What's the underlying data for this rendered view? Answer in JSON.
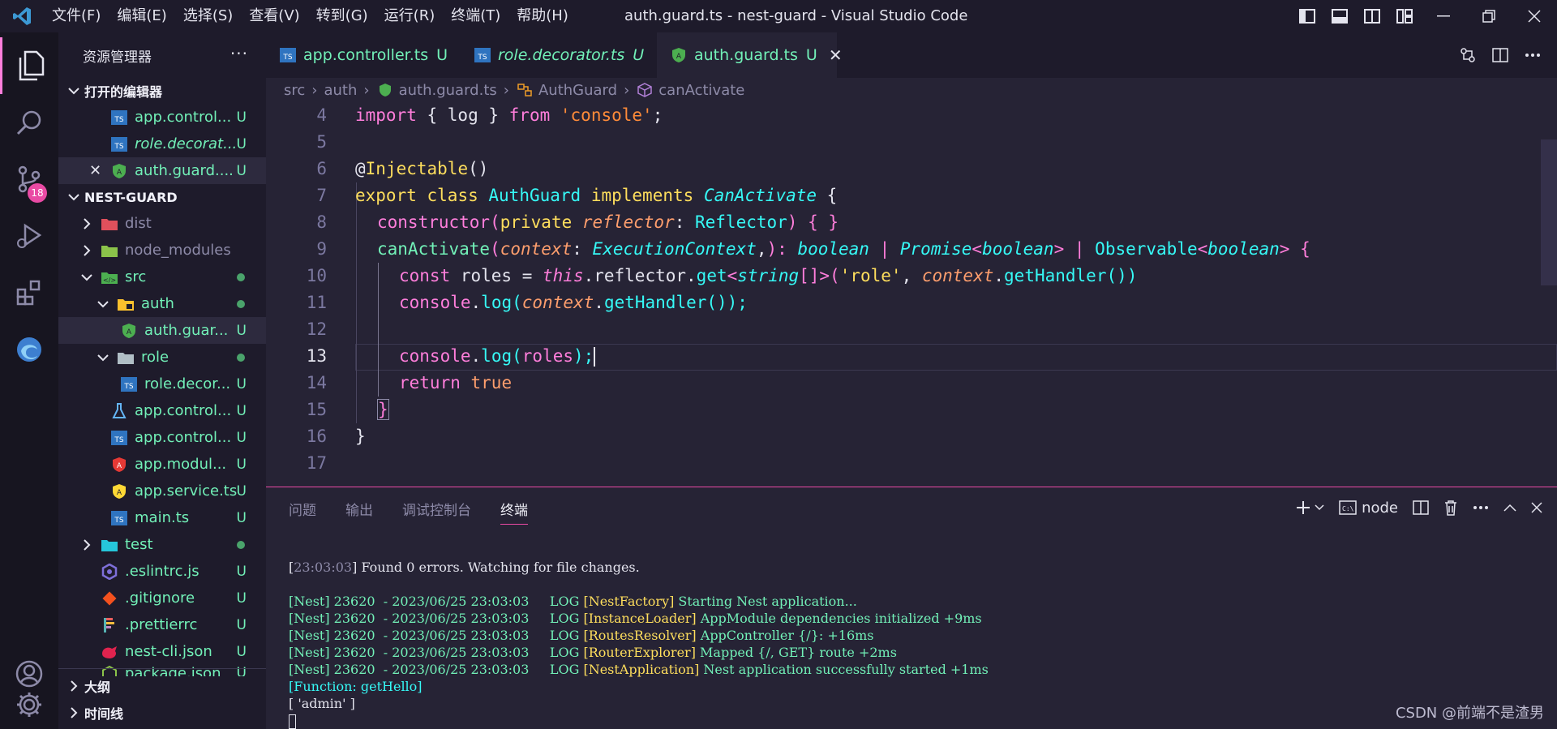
{
  "window": {
    "title": "auth.guard.ts - nest-guard - Visual Studio Code",
    "menu": [
      "文件(F)",
      "编辑(E)",
      "选择(S)",
      "查看(V)",
      "转到(G)",
      "运行(R)",
      "终端(T)",
      "帮助(H)"
    ]
  },
  "activity": {
    "scm_badge": "18"
  },
  "sidebar": {
    "title": "资源管理器",
    "dots": "···",
    "open_editors_title": "打开的编辑器",
    "open_editors": [
      {
        "name": "app.control...",
        "status": "U"
      },
      {
        "name": "role.decorat...",
        "status": "U"
      },
      {
        "name": "auth.guard....",
        "status": "U"
      }
    ],
    "project_title": "NEST-GUARD",
    "tree": [
      {
        "name": "dist"
      },
      {
        "name": "node_modules"
      },
      {
        "name": "src"
      },
      {
        "name": "auth"
      },
      {
        "name": "auth.guar...",
        "status": "U"
      },
      {
        "name": "role"
      },
      {
        "name": "role.decor...",
        "status": "U"
      },
      {
        "name": "app.control...",
        "status": "U"
      },
      {
        "name": "app.control...",
        "status": "U"
      },
      {
        "name": "app.modul...",
        "status": "U"
      },
      {
        "name": "app.service.ts",
        "status": "U"
      },
      {
        "name": "main.ts",
        "status": "U"
      },
      {
        "name": "test"
      },
      {
        "name": ".eslintrc.js",
        "status": "U"
      },
      {
        "name": ".gitignore",
        "status": "U"
      },
      {
        "name": ".prettierrc",
        "status": "U"
      },
      {
        "name": "nest-cli.json",
        "status": "U"
      },
      {
        "name": "package.json",
        "status": "U"
      }
    ],
    "outline_title": "大纲",
    "timeline_title": "时间线"
  },
  "tabs": [
    {
      "label": "app.controller.ts",
      "status": "U"
    },
    {
      "label": "role.decorator.ts",
      "status": "U"
    },
    {
      "label": "auth.guard.ts",
      "status": "U"
    }
  ],
  "breadcrumb": [
    "src",
    "auth",
    "auth.guard.ts",
    "AuthGuard",
    "canActivate"
  ],
  "editor": {
    "line_numbers": [
      "4",
      "5",
      "6",
      "7",
      "8",
      "9",
      "10",
      "11",
      "12",
      "13",
      "14",
      "15",
      "16",
      "17"
    ],
    "tokens": {
      "l4": [
        "import",
        " { log } ",
        "from",
        " ",
        "'console'",
        ";"
      ],
      "l6": [
        "@",
        "Injectable",
        "()"
      ],
      "l7": [
        "export",
        " ",
        "class",
        " ",
        "AuthGuard",
        " ",
        "implements",
        " ",
        "CanActivate",
        " {"
      ],
      "l8": [
        "constructor",
        "(",
        "private",
        " ",
        "reflector",
        ": ",
        "Reflector",
        ") { }"
      ],
      "l9": [
        "canActivate",
        "(",
        "context",
        ": ",
        "ExecutionContext",
        ",",
        "): ",
        "boolean",
        " | ",
        "Promise",
        "<",
        "boolean",
        ">",
        " | ",
        "Observable",
        "<",
        "boolean",
        ">",
        " {"
      ],
      "l10": [
        "const",
        " roles = ",
        "this",
        ".reflector.",
        "get",
        "<",
        "string",
        "[]>(",
        "'role'",
        ", ",
        "context",
        ".",
        "getHandler",
        "())"
      ],
      "l11": [
        "console",
        ".",
        "log",
        "(",
        "context",
        ".",
        "getHandler",
        "());"
      ],
      "l13": [
        "console",
        ".",
        "log",
        "(",
        "roles",
        ");"
      ],
      "l14": [
        "return",
        " ",
        "true"
      ],
      "l15": [
        "}"
      ],
      "l16": [
        "}"
      ]
    }
  },
  "panel": {
    "tabs": [
      "问题",
      "输出",
      "调试控制台",
      "终端"
    ],
    "terminal_label": "node",
    "lines": [
      {
        "a": "[",
        "b": "23:03:03",
        "c": "] Found 0 errors. Watching for file changes."
      },
      {
        "a": "",
        "b": "",
        "c": ""
      },
      {
        "a": "[Nest] 23620  - 2023/06/25 23:03:03     LOG ",
        "b": "[NestFactory]",
        "c": " Starting Nest application..."
      },
      {
        "a": "[Nest] 23620  - 2023/06/25 23:03:03     LOG ",
        "b": "[InstanceLoader]",
        "c": " AppModule dependencies initialized +9ms"
      },
      {
        "a": "[Nest] 23620  - 2023/06/25 23:03:03     LOG ",
        "b": "[RoutesResolver]",
        "c": " AppController {/}: +16ms"
      },
      {
        "a": "[Nest] 23620  - 2023/06/25 23:03:03     LOG ",
        "b": "[RouterExplorer]",
        "c": " Mapped {/, GET} route +2ms"
      },
      {
        "a": "[Nest] 23620  - 2023/06/25 23:03:03     LOG ",
        "b": "[NestApplication]",
        "c": " Nest application successfully started +1ms"
      }
    ],
    "fn_line": "[Function: getHello]",
    "arr_line": "[ 'admin' ]"
  },
  "watermark": "CSDN @前端不是渣男",
  "colors": {
    "accent": "#ff7edb",
    "green": "#72f1b8",
    "bg": "#262335"
  }
}
